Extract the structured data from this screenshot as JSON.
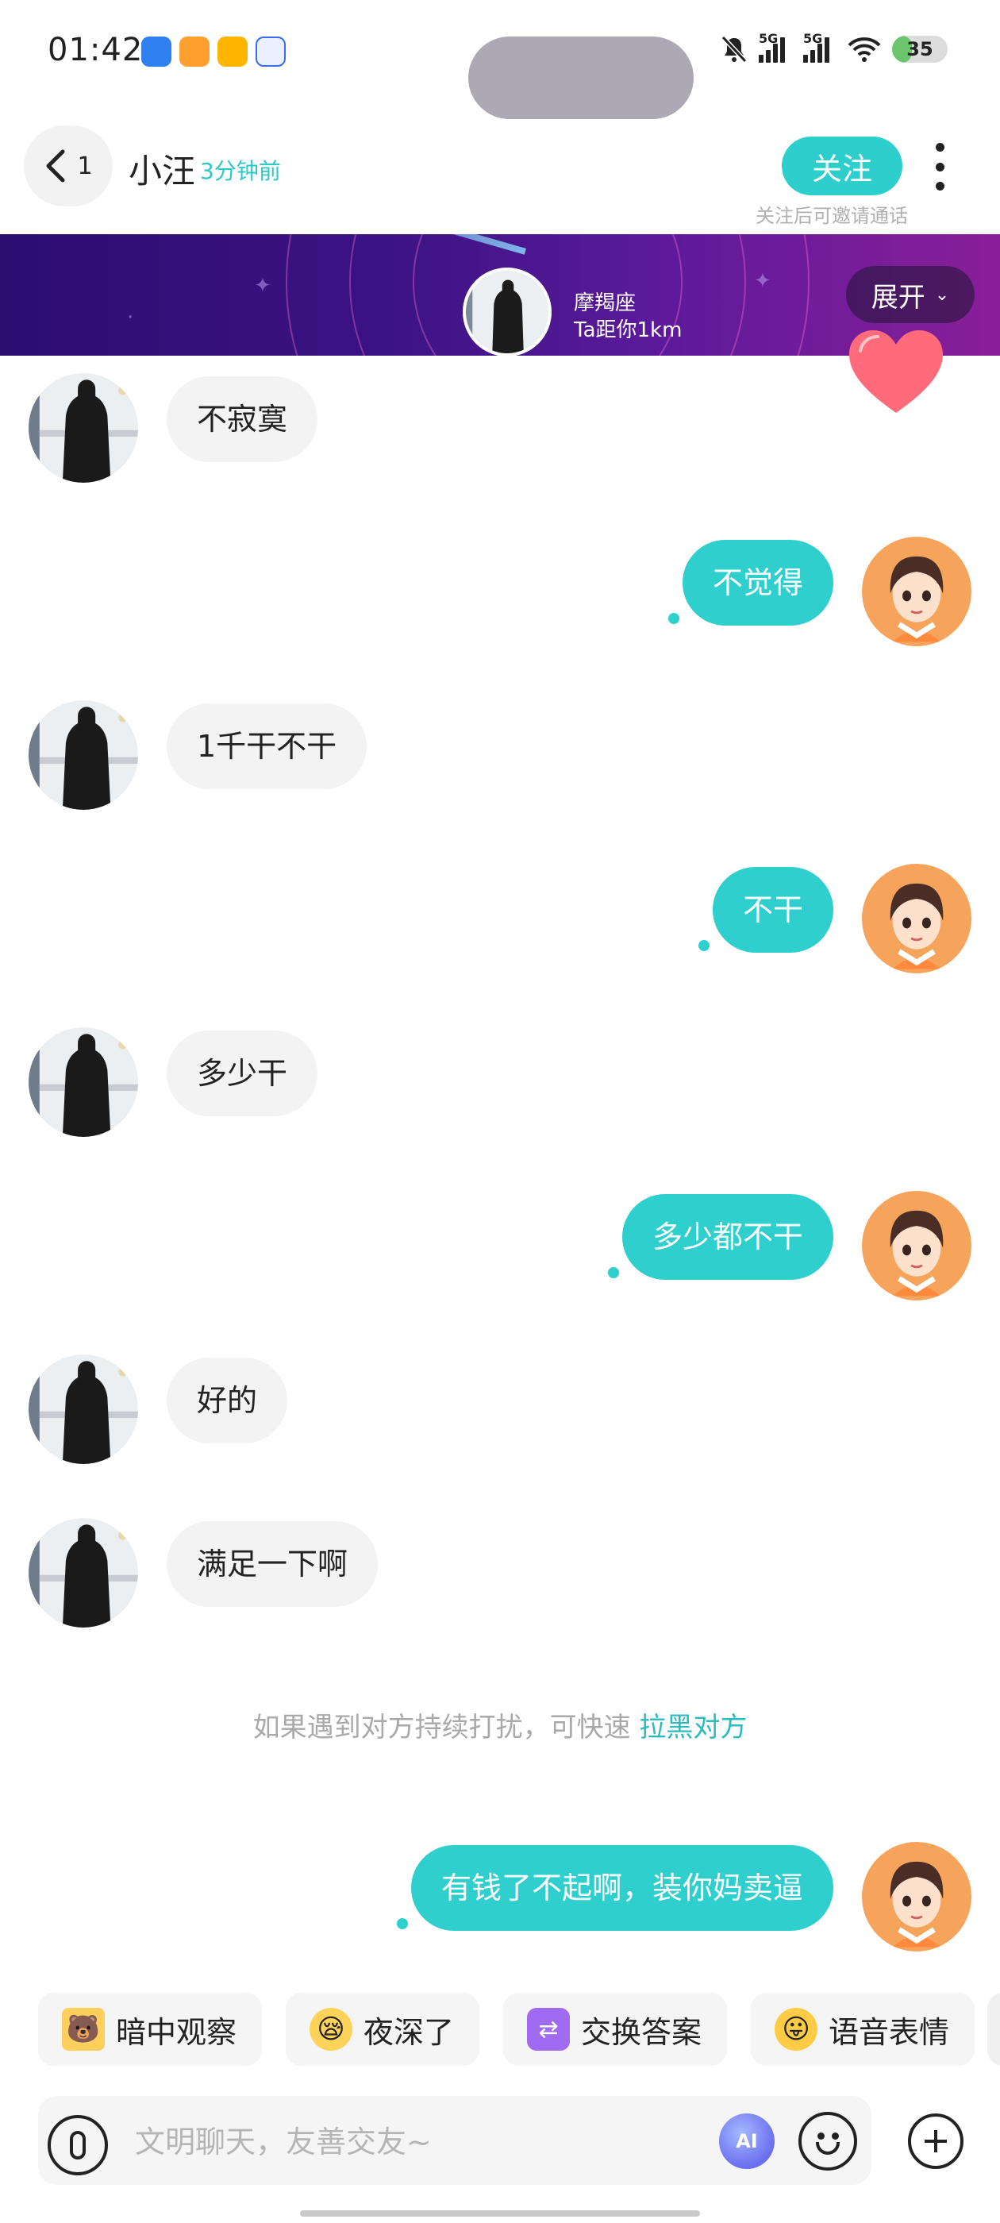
{
  "status_bar": {
    "time": "01:42",
    "network_1": "5G",
    "network_2": "5G",
    "battery": "35",
    "battery_level": 0.35
  },
  "header": {
    "unread_count": "1",
    "name": "小汪",
    "last_seen": "3分钟前",
    "follow_label": "关注",
    "follow_hint": "关注后可邀请通话"
  },
  "banner": {
    "zodiac": "摩羯座",
    "distance": "Ta距你1km",
    "expand_label": "展开"
  },
  "messages": [
    {
      "side": "in",
      "text": "不寂寞"
    },
    {
      "side": "out",
      "text": "不觉得"
    },
    {
      "side": "in",
      "text": "1千干不干"
    },
    {
      "side": "out",
      "text": "不干"
    },
    {
      "side": "in",
      "text": "多少干"
    },
    {
      "side": "out",
      "text": "多少都不干"
    },
    {
      "side": "in",
      "text": "好的"
    },
    {
      "side": "in",
      "text": "满足一下啊"
    },
    {
      "side": "out",
      "text": "有钱了不起啊，装你妈卖逼"
    }
  ],
  "notice": {
    "text": "如果遇到对方持续打扰，可快速 ",
    "link": "拉黑对方"
  },
  "quick_actions": [
    {
      "label": "暗中观察",
      "icon": "peek-emoji-icon"
    },
    {
      "label": "夜深了",
      "icon": "sleepy-emoji-icon"
    },
    {
      "label": "交换答案",
      "icon": "exchange-icon"
    },
    {
      "label": "语音表情",
      "icon": "voice-emoji-icon"
    }
  ],
  "input": {
    "placeholder": "文明聊天，友善交友~",
    "ai_label": "AI"
  },
  "colors": {
    "accent": "#2ecfcd",
    "incoming_bubble": "#f3f3f3",
    "banner_start": "#2b0d70",
    "banner_end": "#8a1e99"
  }
}
